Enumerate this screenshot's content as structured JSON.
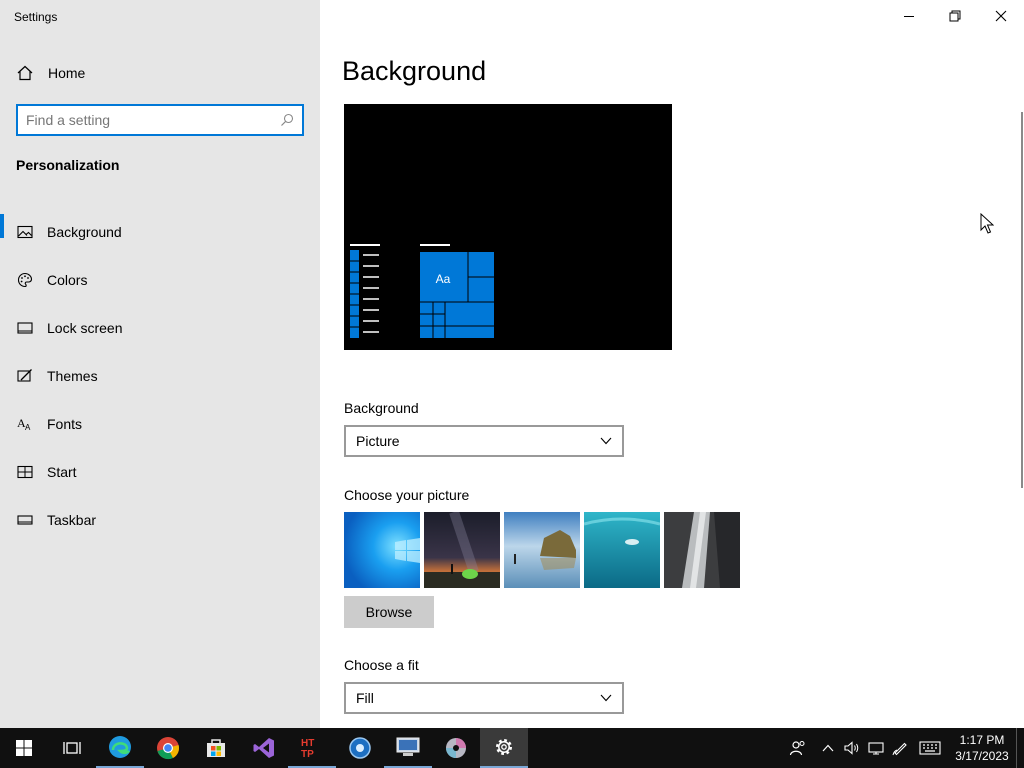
{
  "window": {
    "title": "Settings"
  },
  "sidebar": {
    "home_label": "Home",
    "search_placeholder": "Find a setting",
    "section_title": "Personalization",
    "items": [
      {
        "label": "Background",
        "icon": "picture-icon",
        "active": true
      },
      {
        "label": "Colors",
        "icon": "palette-icon"
      },
      {
        "label": "Lock screen",
        "icon": "lock-screen-icon"
      },
      {
        "label": "Themes",
        "icon": "themes-icon"
      },
      {
        "label": "Fonts",
        "icon": "fonts-icon"
      },
      {
        "label": "Start",
        "icon": "start-icon"
      },
      {
        "label": "Taskbar",
        "icon": "taskbar-icon"
      }
    ]
  },
  "main": {
    "page_title": "Background",
    "preview_tile_text": "Aa",
    "background_label": "Background",
    "background_value": "Picture",
    "choose_picture_label": "Choose your picture",
    "browse_label": "Browse",
    "fit_label": "Choose a fit",
    "fit_value": "Fill"
  },
  "taskbar": {
    "apps": [
      "start-icon",
      "task-view-icon",
      "edge-icon",
      "chrome-icon",
      "store-icon",
      "visual-studio-icon",
      "http-tool-icon",
      "media-player-icon",
      "network-tool-icon",
      "dvd-icon",
      "settings-icon"
    ],
    "time": "1:17 PM",
    "date": "3/17/2023"
  },
  "colors": {
    "accent": "#0078d7",
    "sidebar_bg": "#e6e6e6",
    "taskbar_bg": "#101010"
  }
}
